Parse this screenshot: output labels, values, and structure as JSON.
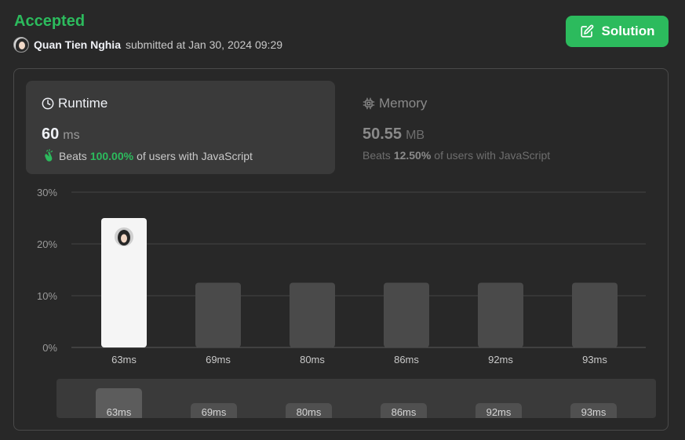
{
  "header": {
    "status": "Accepted",
    "submitter": "Quan Tien Nghia",
    "submitted_text": "submitted at Jan 30, 2024 09:29",
    "solution_label": "Solution"
  },
  "runtime": {
    "title": "Runtime",
    "value": "60",
    "unit": "ms",
    "beats_prefix": "Beats",
    "beats_pct": "100.00%",
    "beats_suffix": "of users with JavaScript"
  },
  "memory": {
    "title": "Memory",
    "value": "50.55",
    "unit": "MB",
    "beats_prefix": "Beats",
    "beats_pct": "12.50%",
    "beats_suffix": "of users with JavaScript"
  },
  "colors": {
    "accent_green": "#2cbb5d",
    "active_bar": "#f5f5f5",
    "inactive_bar": "#4a4a4a"
  },
  "chart_data": {
    "type": "bar",
    "categories": [
      "63ms",
      "69ms",
      "80ms",
      "86ms",
      "92ms",
      "93ms"
    ],
    "values": [
      25,
      12.5,
      12.5,
      12.5,
      12.5,
      12.5
    ],
    "ylim": [
      0,
      30
    ],
    "yticks": [
      "0%",
      "10%",
      "20%",
      "30%"
    ],
    "ytick_values": [
      0,
      10,
      20,
      30
    ],
    "highlight_index": 0,
    "grid": true
  },
  "overview": {
    "labels": [
      "63ms",
      "69ms",
      "80ms",
      "86ms",
      "92ms",
      "93ms"
    ],
    "active_index": 0
  }
}
